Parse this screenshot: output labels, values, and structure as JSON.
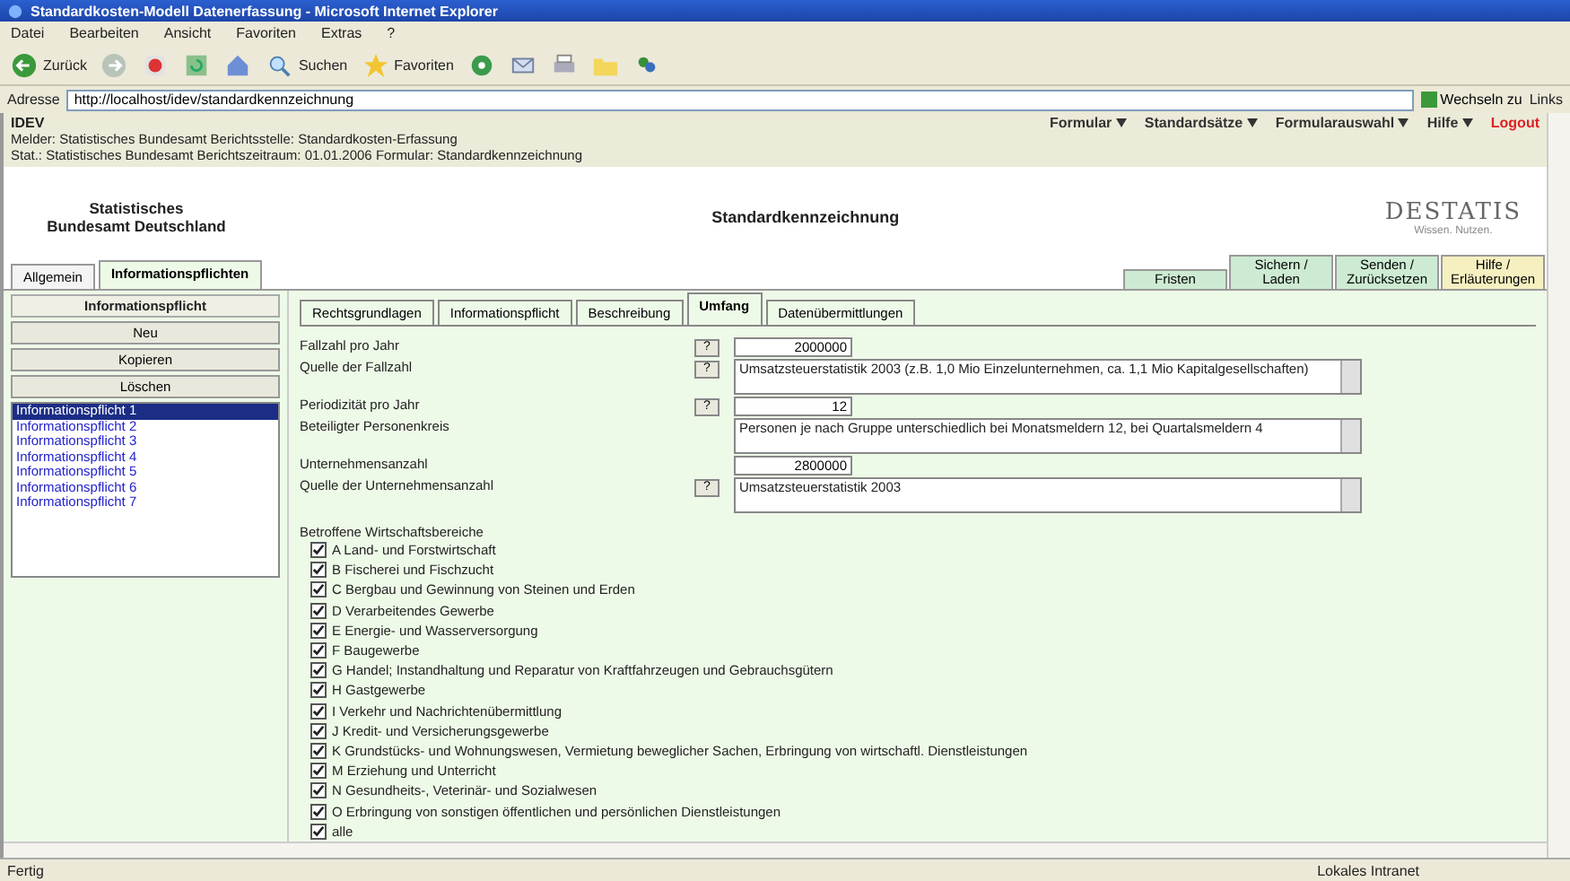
{
  "window": {
    "title": "Standardkosten-Modell Datenerfassung - Microsoft Internet Explorer"
  },
  "menu": [
    "Datei",
    "Bearbeiten",
    "Ansicht",
    "Favoriten",
    "Extras",
    "?"
  ],
  "toolbar": [
    {
      "label": "Zurück",
      "kind": "back"
    },
    {
      "kind": "forward"
    },
    {
      "kind": "stop"
    },
    {
      "kind": "refresh"
    },
    {
      "kind": "home"
    },
    {
      "label": "Suchen",
      "kind": "search"
    },
    {
      "label": "Favoriten",
      "kind": "favorites"
    },
    {
      "kind": "media"
    },
    {
      "kind": "mail"
    },
    {
      "kind": "print"
    },
    {
      "kind": "folder"
    },
    {
      "kind": "messenger"
    }
  ],
  "address": {
    "label": "Adresse",
    "url": "http://localhost/idev/standardkennzeichnung",
    "go": "Wechseln zu",
    "links": "Links"
  },
  "app": {
    "name": "IDEV",
    "nav": [
      "Formular",
      "Standardsätze",
      "Formularauswahl",
      "Hilfe"
    ],
    "logout": "Logout"
  },
  "info_lines": [
    "Melder: Statistisches Bundesamt  Berichtsstelle: Standardkosten-Erfassung",
    "Stat.: Statistisches Bundesamt  Berichtszeitraum: 01.01.2006  Formular: Standardkennzeichnung"
  ],
  "header": {
    "org": "Statistisches Bundesamt Deutschland",
    "title": "Standardkennzeichnung",
    "logo": "DESTATIS",
    "tagline": "Wissen. Nutzen."
  },
  "main_tabs": [
    {
      "label": "Allgemein",
      "selected": false
    },
    {
      "label": "Informationspflichten",
      "selected": true
    }
  ],
  "action_tabs": [
    {
      "label": "Fristen",
      "color": "#cdebd2"
    },
    {
      "label": "Sichern / Laden",
      "color": "#cdebd2"
    },
    {
      "label": "Senden / Zurücksetzen",
      "color": "#cdebd2"
    },
    {
      "label": "Hilfe / Erläuterungen",
      "color": "#f6f0c0"
    }
  ],
  "sidebar": {
    "heading": "Informationspflicht",
    "buttons": [
      "Neu",
      "Kopieren",
      "Löschen"
    ],
    "items": [
      {
        "label": "Informationspflicht 1",
        "selected": true
      },
      {
        "label": "Informationspflicht 2",
        "selected": false
      },
      {
        "label": "Informationspflicht 3",
        "selected": false
      },
      {
        "label": "Informationspflicht 4",
        "selected": false
      },
      {
        "label": "Informationspflicht 5",
        "selected": false
      },
      {
        "label": "Informationspflicht 6",
        "selected": false
      },
      {
        "label": "Informationspflicht 7",
        "selected": false
      }
    ]
  },
  "sub_tabs": [
    {
      "label": "Rechtsgrundlagen",
      "selected": false
    },
    {
      "label": "Informationspflicht",
      "selected": false
    },
    {
      "label": "Beschreibung",
      "selected": false
    },
    {
      "label": "Umfang",
      "selected": true
    },
    {
      "label": "Datenübermittlungen",
      "selected": false
    }
  ],
  "fields": [
    {
      "label": "Fallzahl pro Jahr",
      "kind": "input",
      "help": "?",
      "value": "2000000"
    },
    {
      "label": "Quelle der Fallzahl",
      "kind": "textarea",
      "help": "?",
      "value": "Umsatzsteuerstatistik 2003 (z.B. 1,0 Mio Einzelunternehmen, ca. 1,1 Mio Kapitalgesellschaften)"
    },
    {
      "label": "Periodizität pro Jahr",
      "kind": "input",
      "help": "?",
      "value": "12"
    },
    {
      "label": "Beteiligter Personenkreis",
      "kind": "textarea",
      "value": "Personen je nach Gruppe unterschiedlich bei Monatsmeldern 12, bei Quartalsmeldern 4"
    },
    {
      "label": "Unternehmensanzahl",
      "kind": "input",
      "value": "2800000"
    },
    {
      "label": "Quelle der Unternehmensanzahl",
      "kind": "textarea",
      "help": "?",
      "value": "Umsatzsteuerstatistik 2003"
    }
  ],
  "sectors": {
    "label": "Betroffene Wirtschaftsbereiche",
    "items": [
      {
        "label": "A Land- und Forstwirtschaft",
        "checked": true
      },
      {
        "label": "B Fischerei und Fischzucht",
        "checked": true
      },
      {
        "label": "C Bergbau und Gewinnung von Steinen und Erden",
        "checked": true
      },
      {
        "label": "D Verarbeitendes Gewerbe",
        "checked": true
      },
      {
        "label": "E Energie- und Wasserversorgung",
        "checked": true
      },
      {
        "label": "F Baugewerbe",
        "checked": true
      },
      {
        "label": "G Handel; Instandhaltung und Reparatur von Kraftfahrzeugen und Gebrauchsgütern",
        "checked": true
      },
      {
        "label": "H Gastgewerbe",
        "checked": true
      },
      {
        "label": "I Verkehr und Nachrichtenübermittlung",
        "checked": true
      },
      {
        "label": "J Kredit- und Versicherungsgewerbe",
        "checked": true
      },
      {
        "label": "K Grundstücks- und Wohnungswesen, Vermietung beweglicher Sachen, Erbringung von wirtschaftl. Dienstleistungen",
        "checked": true
      },
      {
        "label": "M Erziehung und Unterricht",
        "checked": true
      },
      {
        "label": "N Gesundheits-, Veterinär- und Sozialwesen",
        "checked": true
      },
      {
        "label": "O Erbringung von sonstigen öffentlichen und persönlichen Dienstleistungen",
        "checked": true
      },
      {
        "label": "alle",
        "checked": true
      }
    ]
  },
  "status_bar": {
    "text": "Fertig",
    "zone": "Lokales Intranet"
  }
}
